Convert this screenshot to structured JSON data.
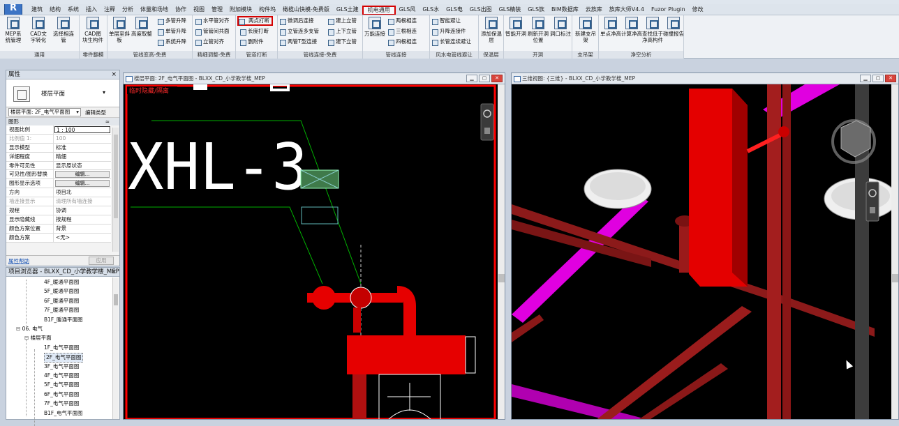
{
  "app": {
    "logo": "R"
  },
  "tabs": [
    {
      "label": "建筑",
      "active": false
    },
    {
      "label": "结构",
      "active": false
    },
    {
      "label": "系统",
      "active": false
    },
    {
      "label": "插入",
      "active": false
    },
    {
      "label": "注释",
      "active": false
    },
    {
      "label": "分析",
      "active": false
    },
    {
      "label": "体量和场地",
      "active": false
    },
    {
      "label": "协作",
      "active": false
    },
    {
      "label": "视图",
      "active": false
    },
    {
      "label": "管理",
      "active": false
    },
    {
      "label": "附加模块",
      "active": false
    },
    {
      "label": "构件坞",
      "active": false
    },
    {
      "label": "橄榄山快模-免费版",
      "active": false
    },
    {
      "label": "GLS土建",
      "active": false
    },
    {
      "label": "机电通用",
      "active": true
    },
    {
      "label": "GLS风",
      "active": false
    },
    {
      "label": "GLS水",
      "active": false
    },
    {
      "label": "GLS电",
      "active": false
    },
    {
      "label": "GLS出图",
      "active": false
    },
    {
      "label": "GLS精装",
      "active": false
    },
    {
      "label": "GLS族",
      "active": false
    },
    {
      "label": "BIM数据库",
      "active": false
    },
    {
      "label": "云族库",
      "active": false
    },
    {
      "label": "族库大师V4.4",
      "active": false
    },
    {
      "label": "Fuzor Plugin",
      "active": false
    },
    {
      "label": "修改",
      "active": false
    }
  ],
  "ribbon": {
    "panels": [
      {
        "label": "通用"
      },
      {
        "label": "零件翻模"
      },
      {
        "label": "管线变高-免费"
      },
      {
        "label": "精细调整-免费"
      },
      {
        "label": "管道打断"
      },
      {
        "label": "管线连接-免费"
      },
      {
        "label": "管线连接"
      },
      {
        "label": "风水电管线避让"
      },
      {
        "label": "保温层"
      },
      {
        "label": "开洞"
      },
      {
        "label": "支吊架"
      },
      {
        "label": "净空分析"
      }
    ],
    "buttons": {
      "mep_sys": "MEP系统管理",
      "cad_text": "CAD文字转化",
      "select_filter": "选择相连管",
      "cad_comp": "CAD图块生构件",
      "slope": "单层至斜板",
      "height_take": "高度取整",
      "multi_lift": "多管升降",
      "single_lift": "单管升降",
      "sys_lift": "系统升降",
      "h_align": "水平管对齐",
      "co_plane": "管管间共面",
      "v_align": "立管对齐",
      "two_point_break": "两点打断",
      "length_break": "长度打断",
      "del_attach": "删附件",
      "micro_connect": "微调后连接",
      "riser_connect": "立管连多支管",
      "two_pipe_t": "两管T型连接",
      "up_down_up": "建上立管",
      "up_down": "上下立管",
      "down_up": "建下立管",
      "universal": "万能连接",
      "two_tee": "两根相连",
      "three_tee": "三根相连",
      "four_tee": "四根相连",
      "smart_avoid": "智能避让",
      "lift_connect": "升降连接件",
      "long_avoid": "长管连续避让",
      "add_insul": "添加保温层",
      "smart_open": "智能开洞",
      "refresh_open": "刷新开洞位置",
      "hole_mark": "洞口标注",
      "new_hanger": "新建支吊架",
      "single_clear": "单点净高",
      "calc_clear": "计算净高",
      "check_lowest": "查找低于净高构件",
      "collision": "碰撞报告"
    }
  },
  "properties": {
    "title": "属性",
    "close": "×",
    "type_name": "楼层平面",
    "filter_value": "楼层平面: 2F_电气平面图",
    "edit_type": "编辑类型",
    "group": "图形",
    "group_collapse": "≈",
    "rows": [
      {
        "k": "视图比例",
        "v": "1 : 100",
        "kind": "input"
      },
      {
        "k": "比例值 1:",
        "v": "100",
        "kind": "dim"
      },
      {
        "k": "显示模型",
        "v": "标准",
        "kind": "text"
      },
      {
        "k": "详细程度",
        "v": "精细",
        "kind": "text"
      },
      {
        "k": "零件可见性",
        "v": "显示原状态",
        "kind": "text"
      },
      {
        "k": "可见性/图形替换",
        "v": "编辑...",
        "kind": "button"
      },
      {
        "k": "图形显示选项",
        "v": "编辑...",
        "kind": "button"
      },
      {
        "k": "方向",
        "v": "项目北",
        "kind": "text"
      },
      {
        "k": "墙连接显示",
        "v": "清理所有墙连接",
        "kind": "dim"
      },
      {
        "k": "规程",
        "v": "协调",
        "kind": "text"
      },
      {
        "k": "显示隐藏线",
        "v": "按规程",
        "kind": "text"
      },
      {
        "k": "颜色方案位置",
        "v": "背景",
        "kind": "text"
      },
      {
        "k": "颜色方案",
        "v": "<无>",
        "kind": "text"
      }
    ],
    "help": "属性帮助",
    "apply": "应用"
  },
  "browser": {
    "title": "项目浏览器 - BLXX_CD_小学教学楼_MEP",
    "close": "×",
    "items": [
      {
        "label": "4F_暖通平面图",
        "level": 3,
        "selected": false
      },
      {
        "label": "5F_暖通平面图",
        "level": 3,
        "selected": false
      },
      {
        "label": "6F_暖通平面图",
        "level": 3,
        "selected": false
      },
      {
        "label": "7F_暖通平面图",
        "level": 3,
        "selected": false
      },
      {
        "label": "B1F_暖通平面图",
        "level": 3,
        "selected": false
      },
      {
        "label": "06. 电气",
        "level": 1,
        "selected": false
      },
      {
        "label": "楼层平面",
        "level": 2,
        "selected": false
      },
      {
        "label": "1F_电气平面图",
        "level": 3,
        "selected": false
      },
      {
        "label": "2F_电气平面图",
        "level": 3,
        "selected": true
      },
      {
        "label": "3F_电气平面图",
        "level": 3,
        "selected": false
      },
      {
        "label": "4F_电气平面图",
        "level": 3,
        "selected": false
      },
      {
        "label": "5F_电气平面图",
        "level": 3,
        "selected": false
      },
      {
        "label": "6F_电气平面图",
        "level": 3,
        "selected": false
      },
      {
        "label": "7F_电气平面图",
        "level": 3,
        "selected": false
      },
      {
        "label": "B1F_电气平面图",
        "level": 3,
        "selected": false
      }
    ]
  },
  "views": {
    "plan": {
      "title": "楼层平面: 2F_电气平面图 - BLXX_CD_小学教学楼_MEP",
      "temp_label": "临时隐藏/隔离",
      "big_text": "XHL-3",
      "colors": {
        "pipe": "#e60000",
        "line": "#00cc00",
        "frame": "#ff0000"
      }
    },
    "view3d": {
      "title": "三维视图: {三维} - BLXX_CD_小学教学楼_MEP",
      "colors": {
        "pipe": "#b32020",
        "magenta": "#e000e0"
      }
    },
    "win_btns": {
      "min": "▁",
      "max": "▢",
      "close": "✕"
    }
  }
}
